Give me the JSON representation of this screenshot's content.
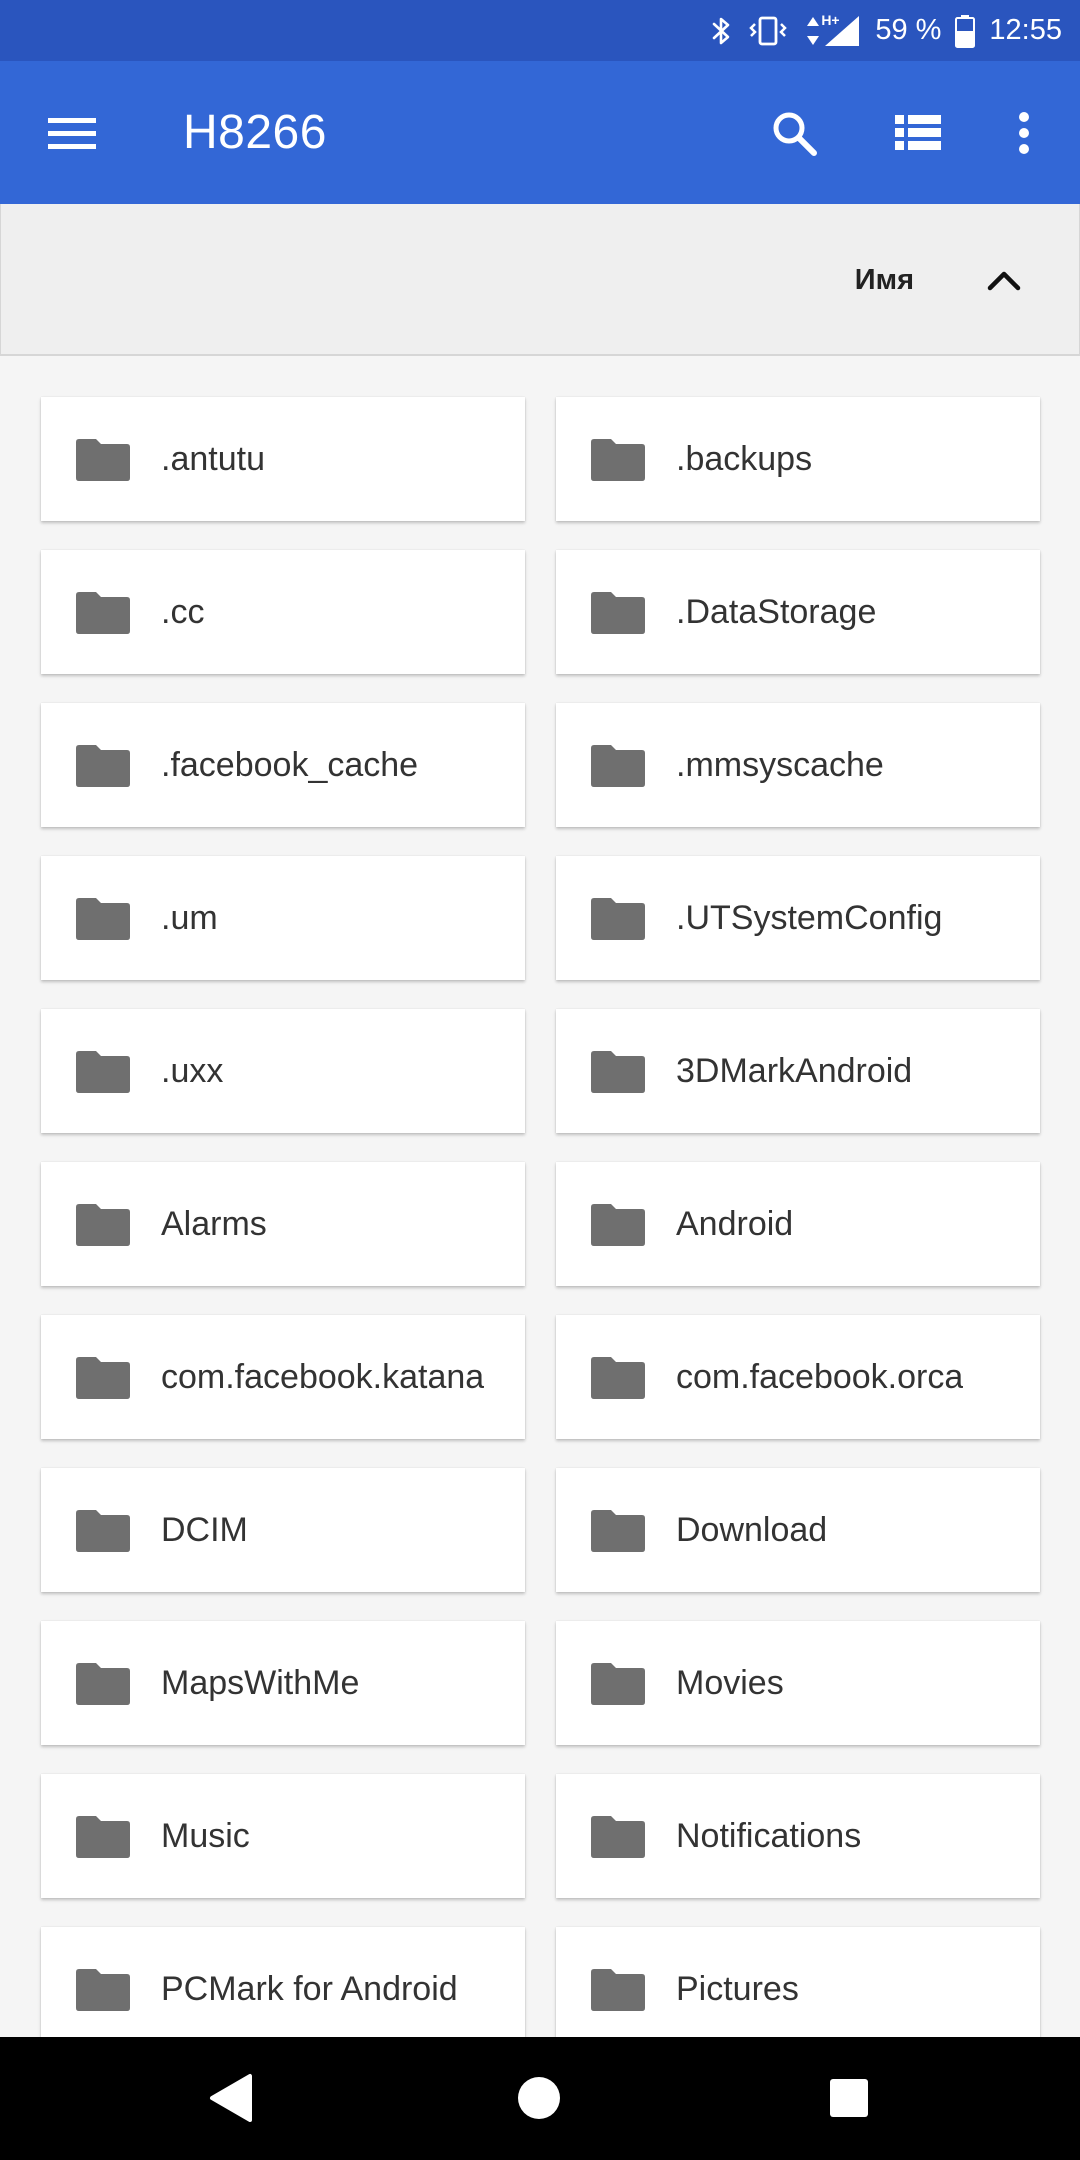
{
  "status_bar": {
    "battery_percent": "59 %",
    "time": "12:55",
    "network_type": "H+",
    "icons": [
      "bluetooth-icon",
      "vibrate-icon",
      "data-activity-icon",
      "signal-icon",
      "battery-icon"
    ]
  },
  "app_bar": {
    "title": "H8266",
    "icons": [
      "menu-icon",
      "search-icon",
      "list-view-icon",
      "more-vert-icon"
    ]
  },
  "sort_bar": {
    "label": "Имя",
    "direction_icon": "chevron-up-icon"
  },
  "folders": [
    ".antutu",
    ".backups",
    ".cc",
    ".DataStorage",
    ".facebook_cache",
    ".mmsyscache",
    ".um",
    ".UTSystemConfig",
    ".uxx",
    "3DMarkAndroid",
    "Alarms",
    "Android",
    "com.facebook.katana",
    "com.facebook.orca",
    "DCIM",
    "Download",
    "MapsWithMe",
    "Movies",
    "Music",
    "Notifications",
    "PCMark for Android",
    "Pictures"
  ],
  "nav_bar": {
    "icons": [
      "back-icon",
      "home-icon",
      "recents-icon"
    ]
  },
  "colors": {
    "status_bar": "#2a55be",
    "app_bar": "#3367d6",
    "folder_icon": "#6f6f6f",
    "background": "#f5f5f5"
  }
}
